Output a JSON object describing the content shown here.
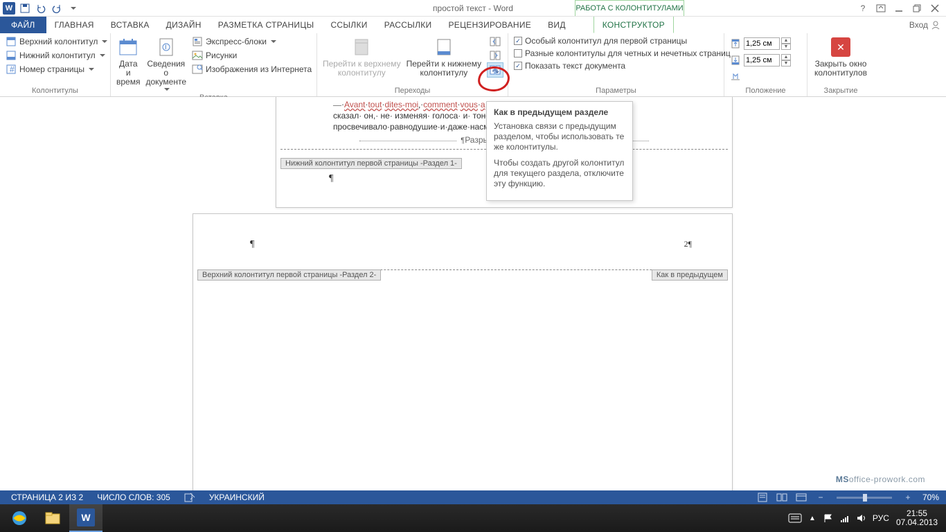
{
  "title": "простой текст - Word",
  "tool_tab_title": "РАБОТА С КОЛОНТИТУЛАМИ",
  "login": "Вход",
  "tabs": {
    "file": "ФАЙЛ",
    "home": "ГЛАВНАЯ",
    "insert": "ВСТАВКА",
    "design": "ДИЗАЙН",
    "layout": "РАЗМЕТКА СТРАНИЦЫ",
    "refs": "ССЫЛКИ",
    "mail": "РАССЫЛКИ",
    "review": "РЕЦЕНЗИРОВАНИЕ",
    "view": "ВИД",
    "ctx": "КОНСТРУКТОР"
  },
  "ribbon": {
    "g1": {
      "label": "Колонтитулы",
      "top": "Верхний колонтитул",
      "bottom": "Нижний колонтитул",
      "page": "Номер страницы"
    },
    "g2": {
      "label": "Вставка",
      "date1": "Дата и",
      "date2": "время",
      "doc1": "Сведения о",
      "doc2": "документе",
      "quick": "Экспресс-блоки",
      "pics": "Рисунки",
      "online": "Изображения из Интернета"
    },
    "g3": {
      "label": "Переходы",
      "goHeader1": "Перейти к верхнему",
      "goHeader2": "колонтитулу",
      "goFooter1": "Перейти к нижнему",
      "goFooter2": "колонтитулу"
    },
    "g4": {
      "label": "Параметры",
      "first": "Особый колонтитул для первой страницы",
      "oddeven": "Разные колонтитулы для четных и нечетных страниц",
      "showdoc": "Показать текст документа"
    },
    "g5": {
      "label": "Положение",
      "val": "1,25 см"
    },
    "g6": {
      "label": "Закрытие",
      "close1": "Закрыть окно",
      "close2": "колонтитулов"
    }
  },
  "tooltip": {
    "title": "Как в предыдущем разделе",
    "p1": "Установка связи с предыдущим разделом, чтобы использовать те же колонтитулы.",
    "p2": "Чтобы создать другой колонтитул для текущего раздела, отключите эту функцию."
  },
  "doc": {
    "line1_a": "Avant",
    "line1_b": "tout",
    "line1_c": "dites-moi",
    "line1_d": "comment",
    "line1_e": "vous",
    "line1_f": "a",
    "line2": "сказал· он,· не· изменяя· голоса· и· тоном",
    "line3": "просвечивало·равнодушие·и·даже·насме",
    "sect_break": "Разрыв раздела (со с",
    "footer_tag": "Нижний колонтитул первой страницы -Раздел 1-",
    "header_tag": "Верхний колонтитул первой страницы -Раздел 2-",
    "same_as_prev": "Как в предыдущем",
    "pg2mark": "2¶"
  },
  "status": {
    "page": "СТРАНИЦА 2 ИЗ 2",
    "words": "ЧИСЛО СЛОВ: 305",
    "lang": "УКРАИНСКИЙ",
    "zoom": "70%"
  },
  "taskbar": {
    "lang": "РУС",
    "time": "21:55",
    "date": "07.04.2013"
  },
  "watermark_b": "MS",
  "watermark_rest": "office-prowork.com"
}
